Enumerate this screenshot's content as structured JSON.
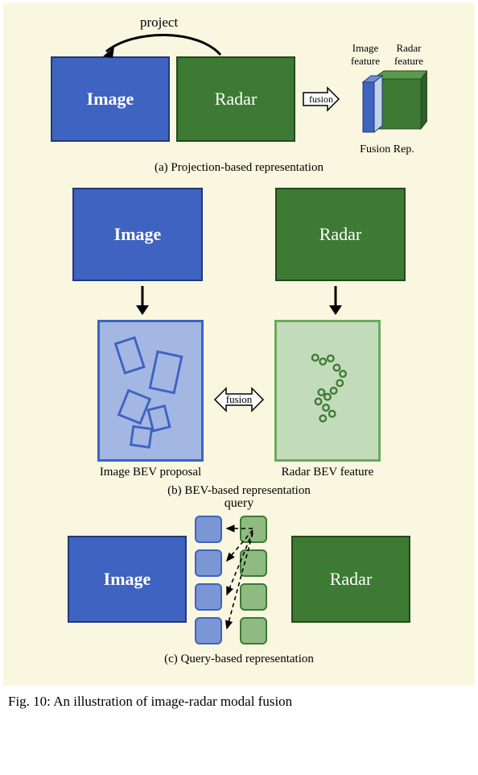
{
  "panel_a": {
    "image_label": "Image",
    "radar_label": "Radar",
    "project_label": "project",
    "fusion_label": "fusion",
    "cube_label_image": "Image feature",
    "cube_label_radar": "Radar feature",
    "fusion_rep_label": "Fusion Rep.",
    "caption": "(a) Projection-based representation"
  },
  "panel_b": {
    "image_label": "Image",
    "radar_label": "Radar",
    "fusion_label": "fusion",
    "bev_image_label": "Image BEV proposal",
    "bev_radar_label": "Radar BEV feature",
    "caption": "(b) BEV-based representation"
  },
  "panel_c": {
    "image_label": "Image",
    "radar_label": "Radar",
    "query_label": "query",
    "caption": "(c) Query-based representation"
  },
  "figure_caption": "Fig. 10: An illustration of image-radar modal fusion"
}
